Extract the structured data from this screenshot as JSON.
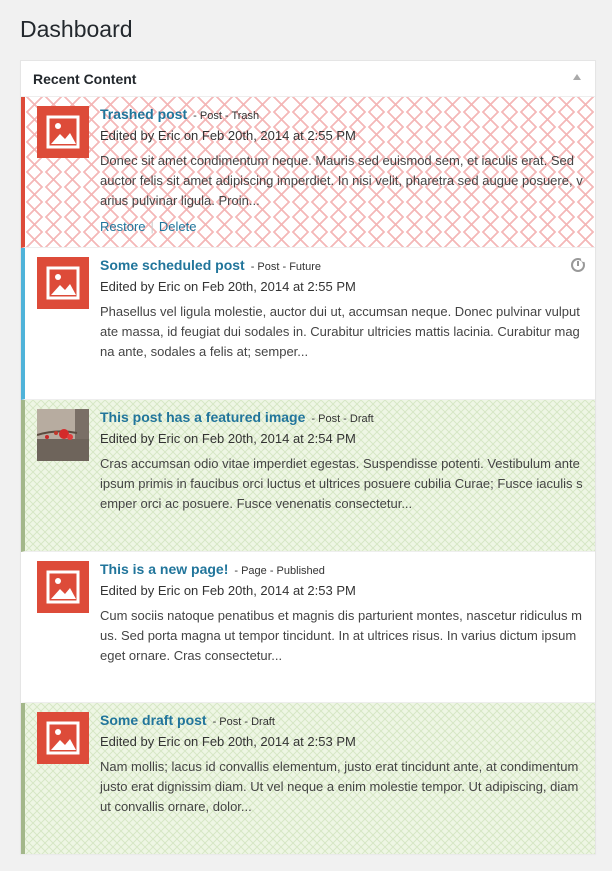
{
  "page": {
    "title": "Dashboard"
  },
  "widget": {
    "title": "Recent Content"
  },
  "items": [
    {
      "title": "Trashed post",
      "meta": "- Post - Trash",
      "edited": "Edited by Eric on Feb 20th, 2014 at 2:55 PM",
      "excerpt": "Donec sit amet condimentum neque. Mauris sed euismod sem, et iaculis erat. Sed auctor felis sit amet adipiscing imperdiet. In nisi velit, pharetra sed augue posuere, varius pulvinar ligula. Proin...",
      "actions": {
        "restore": "Restore",
        "delete": "Delete"
      }
    },
    {
      "title": "Some scheduled post",
      "meta": "- Post - Future",
      "edited": "Edited by Eric on Feb 20th, 2014 at 2:55 PM",
      "excerpt": "Phasellus vel ligula molestie, auctor dui ut, accumsan neque. Donec pulvinar vulputate massa, id feugiat dui sodales in. Curabitur ultricies mattis lacinia. Curabitur magna ante, sodales a felis at; semper..."
    },
    {
      "title": "This post has a featured image",
      "meta": "- Post - Draft",
      "edited": "Edited by Eric on Feb 20th, 2014 at 2:54 PM",
      "excerpt": "Cras accumsan odio vitae imperdiet egestas. Suspendisse potenti. Vestibulum ante ipsum primis in faucibus orci luctus et ultrices posuere cubilia Curae; Fusce iaculis semper orci ac posuere. Fusce venenatis consectetur..."
    },
    {
      "title": "This is a new page!",
      "meta": "- Page - Published",
      "edited": "Edited by Eric on Feb 20th, 2014 at 2:53 PM",
      "excerpt": "Cum sociis natoque penatibus et magnis dis parturient montes, nascetur ridiculus mus. Sed porta magna ut tempor tincidunt. In at ultrices risus. In varius dictum ipsum eget ornare. Cras consectetur..."
    },
    {
      "title": "Some draft post",
      "meta": "- Post - Draft",
      "edited": "Edited by Eric on Feb 20th, 2014 at 2:53 PM",
      "excerpt": "Nam mollis; lacus id convallis elementum, justo erat tincidunt ante, at condimentum justo erat dignissim diam. Ut vel neque a enim molestie tempor. Ut adipiscing, diam ut convallis ornare, dolor..."
    }
  ],
  "icons": {
    "placeholder": "image-placeholder-icon",
    "schedule": "clock-icon",
    "collapse": "triangle-up-icon"
  },
  "colors": {
    "trash": "#dd4b39",
    "future": "#4fb3d9",
    "draft": "#a3b78a",
    "link": "#21759b"
  }
}
